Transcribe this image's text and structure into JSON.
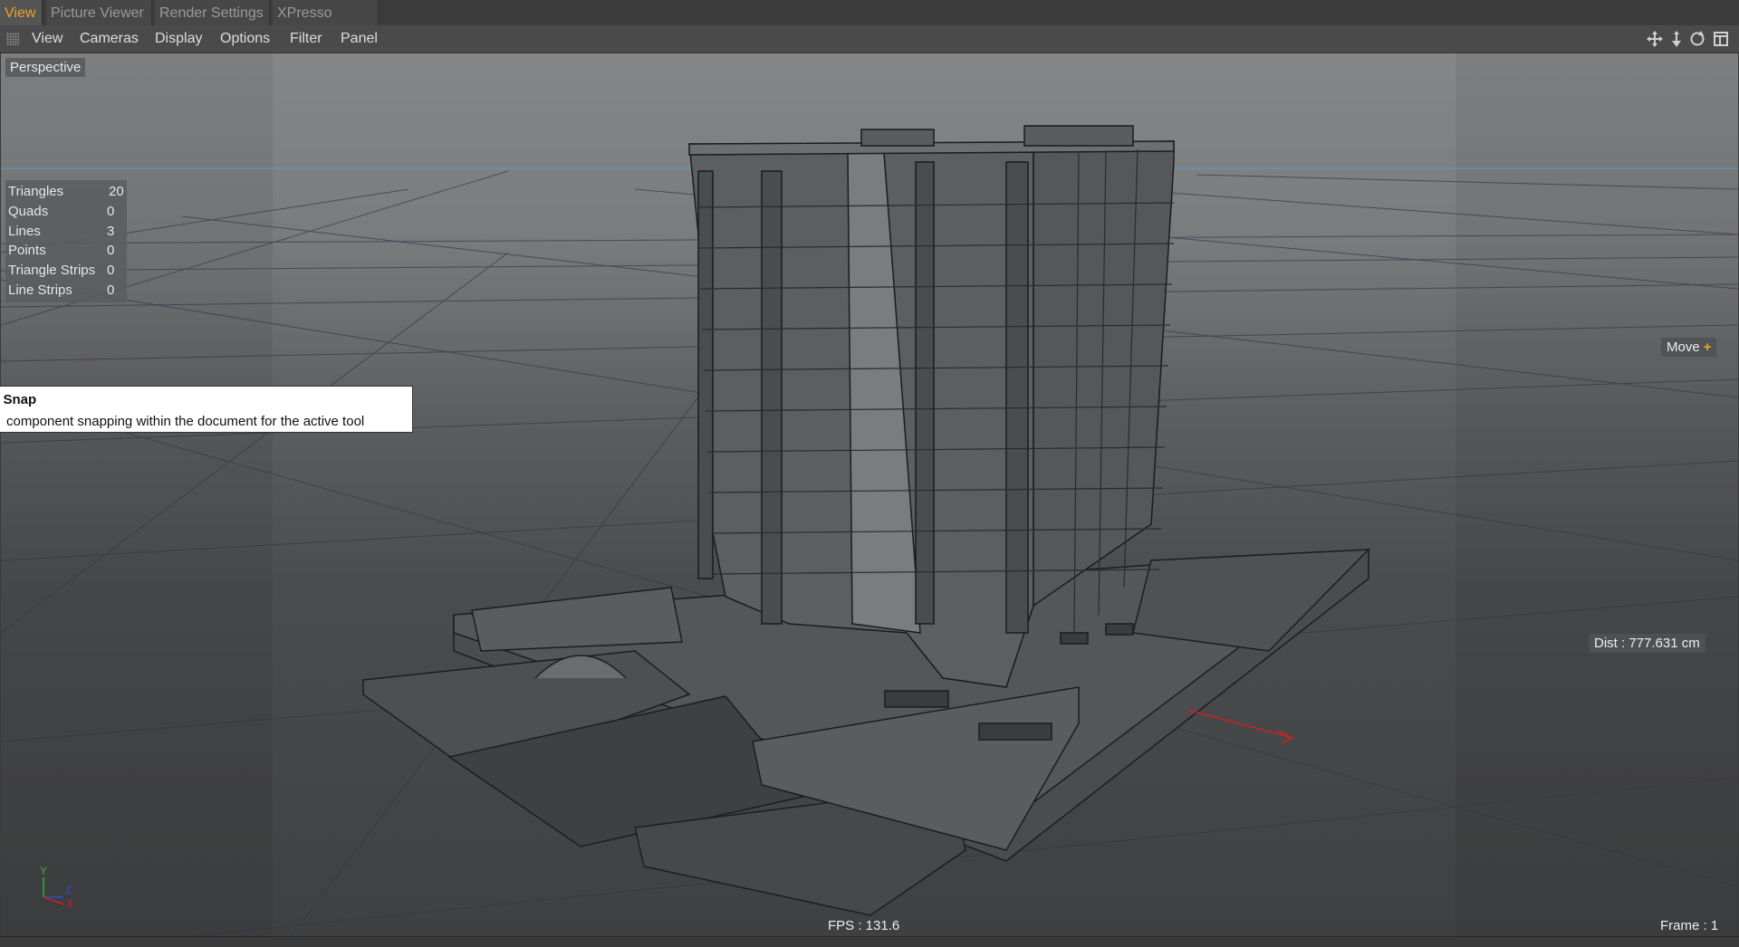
{
  "tabs": [
    {
      "label": "View",
      "active": true
    },
    {
      "label": "Picture Viewer",
      "active": false
    },
    {
      "label": "Render Settings",
      "active": false
    },
    {
      "label": "XPresso Editor",
      "active": false
    }
  ],
  "menu": [
    "View",
    "Cameras",
    "Display",
    "Options",
    "Filter",
    "Panel"
  ],
  "nav_icons": [
    "move-view-icon",
    "zoom-view-icon",
    "rotate-view-icon",
    "toggle-layout-icon"
  ],
  "viewport": {
    "camera_label": "Perspective",
    "stats": [
      {
        "label": "Triangles",
        "value": "20"
      },
      {
        "label": "Quads",
        "value": "0"
      },
      {
        "label": "Lines",
        "value": "3"
      },
      {
        "label": "Points",
        "value": "0"
      },
      {
        "label": "Triangle Strips",
        "value": "0"
      },
      {
        "label": "Line Strips",
        "value": "0"
      }
    ],
    "tooltip": {
      "title": "e Snap",
      "description": "component snapping within the document for the active tool"
    },
    "move_label": "Move",
    "move_icon": "plus-icon",
    "dist_label": "Dist : 777.631 cm",
    "fps_label": "FPS : 131.6",
    "frame_label": "Frame : 1",
    "axis_labels": {
      "y": "Y",
      "z": "Z",
      "x": "X"
    }
  },
  "colors": {
    "accent": "#f0a023",
    "building": "#5e6063",
    "edges": "#1e1f21",
    "horizon": "#4aa0d0",
    "axis_x": "#d02020",
    "axis_y": "#30b030",
    "axis_z": "#3050c0"
  }
}
